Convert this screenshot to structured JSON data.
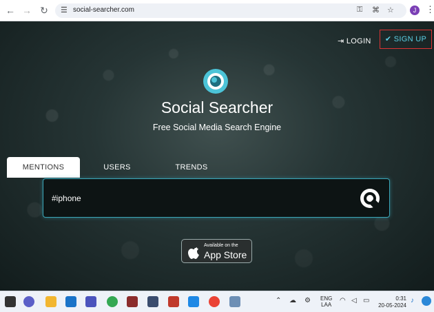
{
  "browser": {
    "url": "social-searcher.com",
    "profile_initial": "J"
  },
  "header": {
    "login_label": "LOGIN",
    "signup_label": "SIGN UP"
  },
  "hero": {
    "brand": "Social Searcher",
    "tagline": "Free Social Media Search Engine"
  },
  "tabs": [
    {
      "label": "MENTIONS",
      "active": true
    },
    {
      "label": "USERS",
      "active": false
    },
    {
      "label": "TRENDS",
      "active": false
    }
  ],
  "search": {
    "value": "#iphone"
  },
  "appstore": {
    "small": "Available on the",
    "big": "App Store"
  },
  "taskbar": {
    "lang_line1": "ENG",
    "lang_line2": "LAA",
    "time": "0:31",
    "date": "20-05-2024"
  },
  "colors": {
    "accent": "#3aa6b8",
    "signup_border": "#dd3333"
  }
}
